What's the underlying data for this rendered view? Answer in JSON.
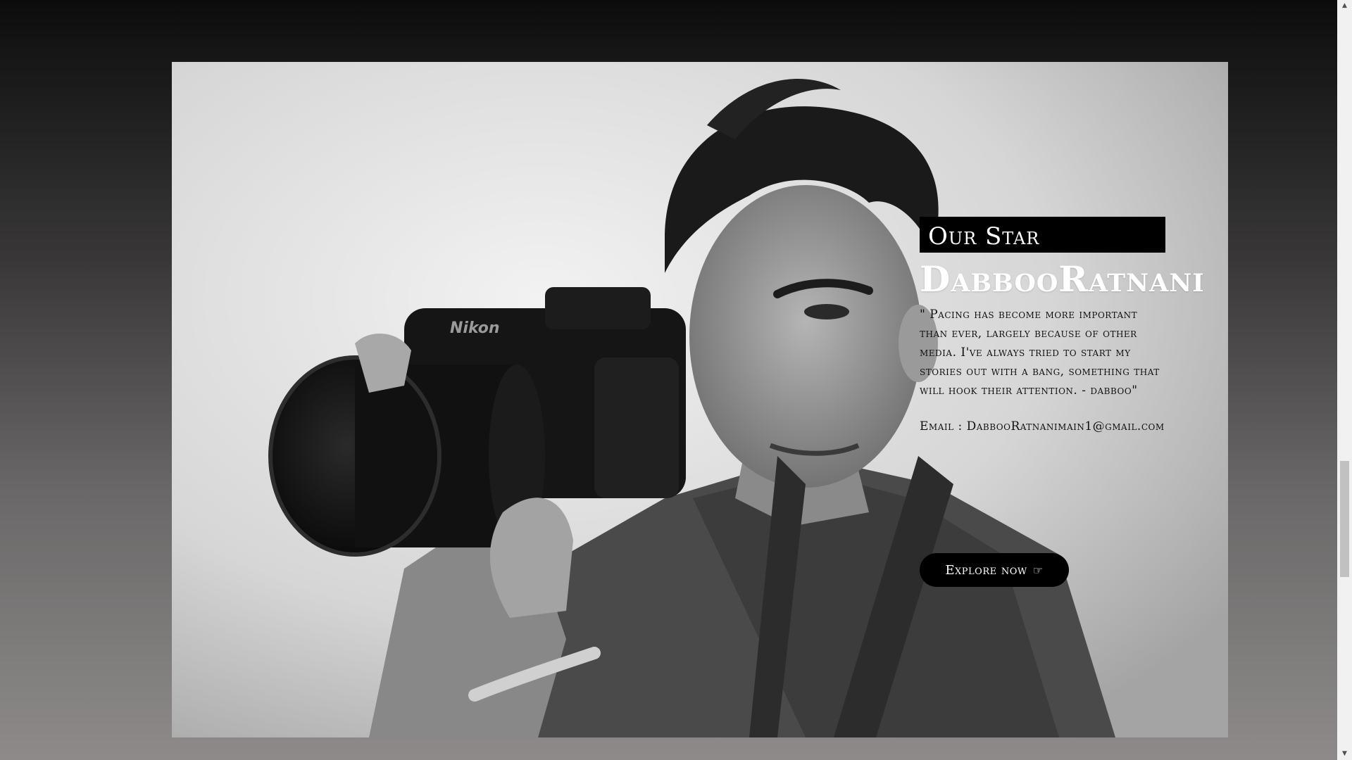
{
  "hero": {
    "label": "Our Star",
    "name": "DabbooRatnani",
    "quote": "\" Pacing has become more important than ever, largely because of other media. I've always tried to start my stories out with a bang, something that will hook their attention. - dabboo\"",
    "email": "Email : DabbooRatnanimain1@gmail.com",
    "button_label": "Explore now",
    "button_icon": "☞",
    "photo_icon": "photographer-with-camera"
  },
  "scrollbar": {
    "up": "▲",
    "down": "▼"
  }
}
